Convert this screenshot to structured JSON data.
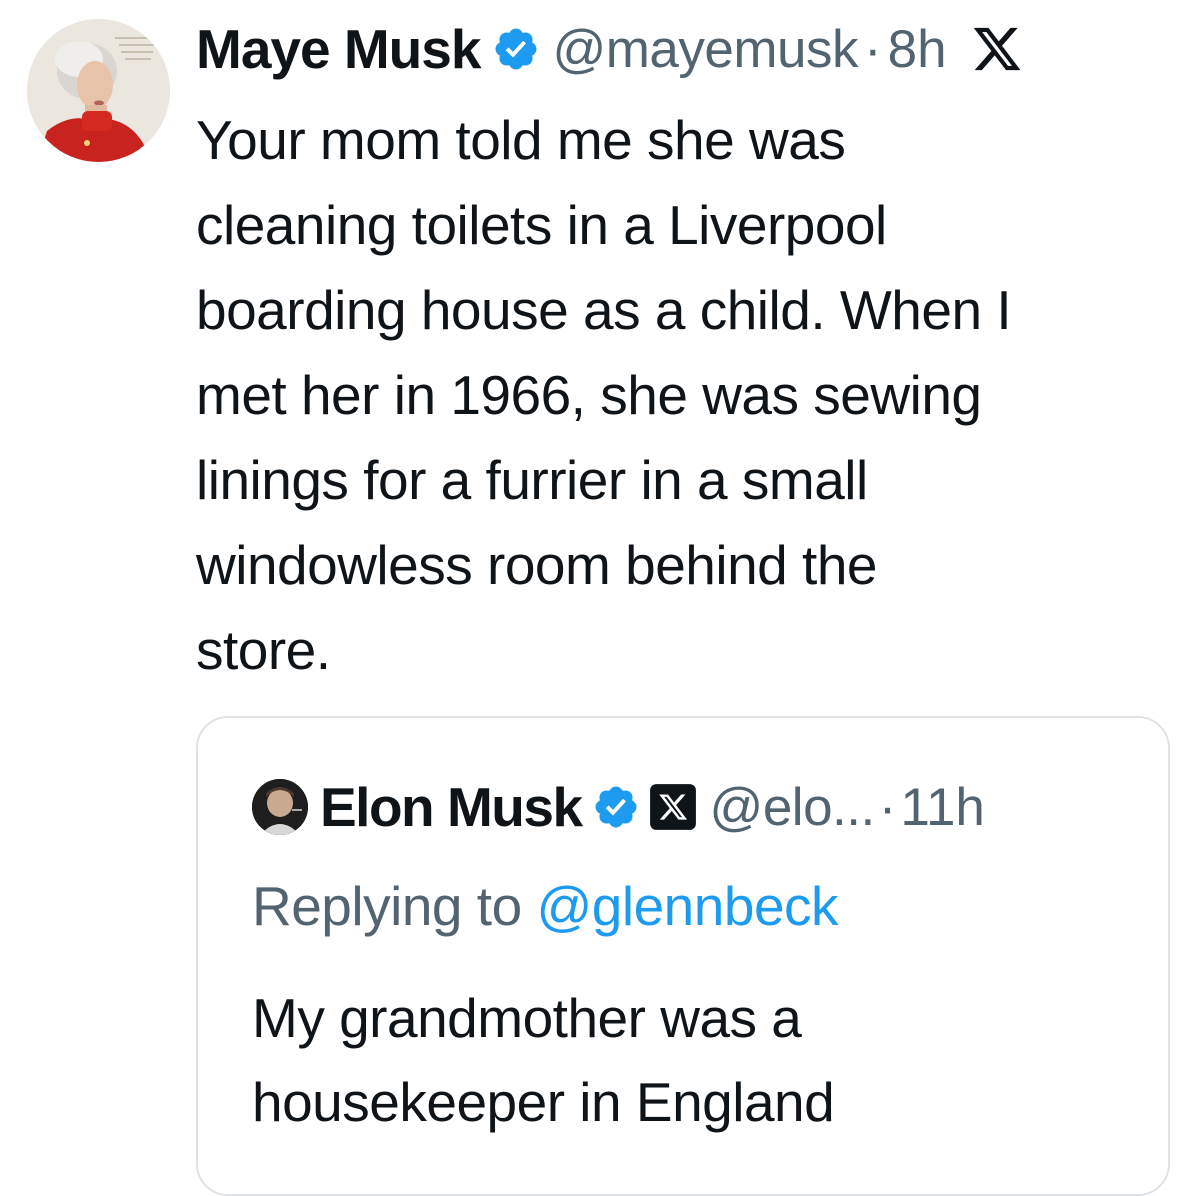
{
  "tweet": {
    "author": {
      "display_name": "Maye Musk",
      "handle": "@mayemusk",
      "verified": true,
      "avatar_icon": "profile-photo"
    },
    "separator": "·",
    "timestamp": "8h",
    "platform_icon": "x-logo-icon",
    "text_lines": [
      "Your mom told me she was",
      "cleaning toilets in a Liverpool",
      "boarding house as a child. When I",
      "met her in 1966, she was sewing",
      "linings for a furrier in a small",
      "windowless room behind the",
      "store."
    ]
  },
  "quoted_tweet": {
    "author": {
      "display_name": "Elon Musk",
      "handle": "@elo...",
      "verified": true,
      "affiliation_icon": "x-affiliate-badge-icon"
    },
    "separator": "·",
    "timestamp": "11h",
    "replying_to_label": "Replying to",
    "replying_to_handle": "@glennbeck",
    "text_lines": [
      "My grandmother was a",
      "housekeeper in England"
    ]
  },
  "colors": {
    "text_primary": "#0f1419",
    "text_secondary": "#536471",
    "link_blue": "#1d9bf0",
    "verified_blue": "#1d9bf0",
    "card_border": "#dfe3e6",
    "background": "#ffffff"
  }
}
